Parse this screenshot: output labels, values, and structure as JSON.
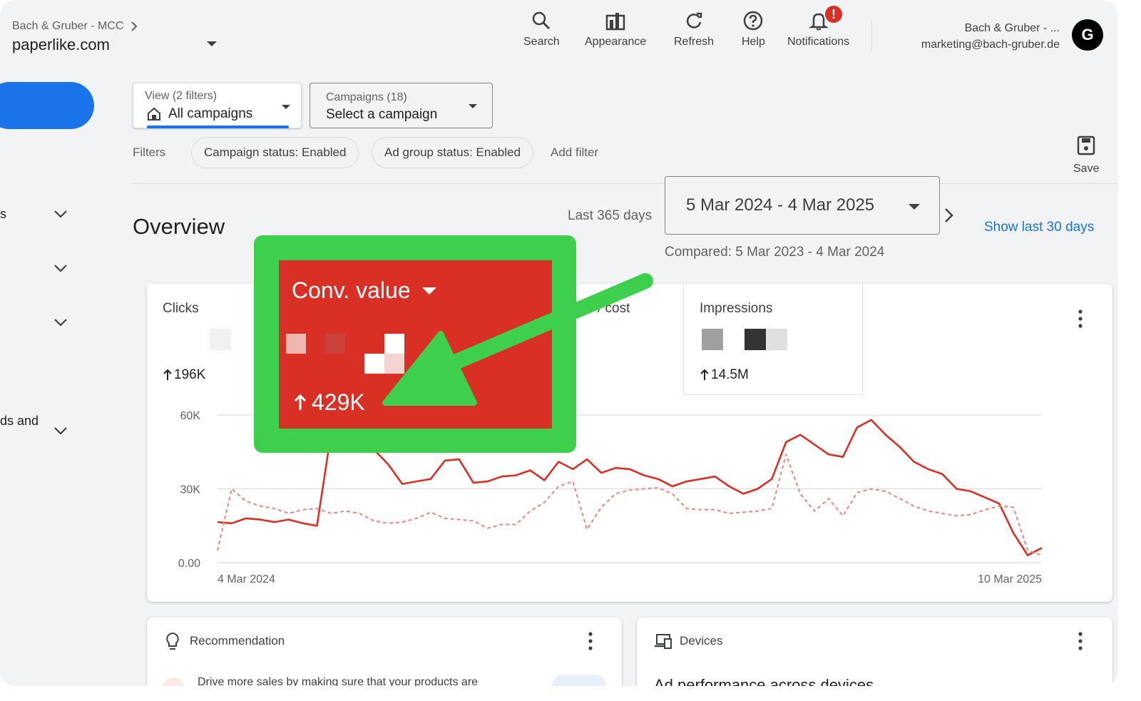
{
  "header": {
    "breadcrumb": "Bach & Gruber - MCC",
    "account": "paperlike.com",
    "tools": [
      {
        "label": "Search",
        "icon": "search-icon"
      },
      {
        "label": "Appearance",
        "icon": "appearance-icon"
      },
      {
        "label": "Refresh",
        "icon": "refresh-icon"
      },
      {
        "label": "Help",
        "icon": "help-icon"
      },
      {
        "label": "Notifications",
        "icon": "bell-icon"
      }
    ],
    "notification_badge": "!",
    "user_name": "Bach & Gruber - ...",
    "user_email": "marketing@bach-gruber.de",
    "avatar_letter": "G"
  },
  "sidebar": {
    "partial_labels": [
      "s",
      "ds and"
    ]
  },
  "view_select": {
    "label": "View (2 filters)",
    "value": "All campaigns"
  },
  "campaign_select": {
    "label": "Campaigns (18)",
    "value": "Select a campaign"
  },
  "filters": {
    "label": "Filters",
    "chips": [
      "Campaign status: Enabled",
      "Ad group status: Enabled"
    ],
    "add": "Add filter"
  },
  "save_label": "Save",
  "overview": {
    "title": "Overview",
    "range_label": "Last 365 days",
    "date_range": "5 Mar 2024 - 4 Mar 2025",
    "compared": "Compared: 5 Mar 2023 - 4 Mar 2024",
    "show_last": "Show last 30 days"
  },
  "metrics": [
    {
      "title": "Clicks",
      "value": "196K"
    },
    {
      "title": "/ cost",
      "value": ""
    },
    {
      "title": "Impressions",
      "value": "14.5M"
    }
  ],
  "overlay": {
    "title": "Conv. value",
    "value": "429K"
  },
  "chart_data": {
    "type": "line",
    "y_ticks": [
      "60K",
      "30K",
      "0.00"
    ],
    "x_ticks": [
      "4 Mar 2024",
      "10 Mar 2025"
    ],
    "ylim": [
      0,
      60000
    ],
    "series": [
      {
        "style": "solid",
        "color": "#d93025",
        "values": [
          16500,
          16000,
          18000,
          17500,
          16500,
          17500,
          16000,
          15000,
          53000,
          72000,
          57000,
          46000,
          40000,
          32000,
          33000,
          34000,
          41500,
          42000,
          32500,
          33000,
          35000,
          35500,
          37500,
          33500,
          41000,
          38000,
          42000,
          36500,
          38500,
          38000,
          35500,
          34000,
          31000,
          33000,
          34000,
          35000,
          31000,
          28000,
          30000,
          34000,
          49000,
          52000,
          48000,
          44000,
          43000,
          55000,
          58000,
          52000,
          47000,
          41000,
          38000,
          36000,
          30000,
          29000,
          26500,
          24000,
          12000,
          3000,
          6000
        ]
      },
      {
        "style": "dashed",
        "color": "#e8857c",
        "values": [
          5000,
          30000,
          25000,
          23000,
          22000,
          20000,
          21500,
          22000,
          20000,
          21000,
          20000,
          17000,
          16000,
          16500,
          18000,
          20500,
          18000,
          17500,
          17000,
          14000,
          15500,
          15500,
          21000,
          24500,
          31000,
          33000,
          13500,
          22500,
          28000,
          29500,
          30000,
          30500,
          28000,
          22000,
          21500,
          21500,
          20000,
          20500,
          21000,
          22000,
          44000,
          28000,
          21000,
          26000,
          19000,
          28500,
          30000,
          29000,
          26000,
          23000,
          21000,
          20000,
          19000,
          19500,
          21500,
          23000,
          22500,
          5000,
          3000
        ]
      }
    ]
  },
  "bottom": {
    "recommendation": "Recommendation",
    "recommendation_text": "Drive more sales by making sure that your products are",
    "devices": "Devices",
    "devices_text": "Ad performance across devices"
  }
}
